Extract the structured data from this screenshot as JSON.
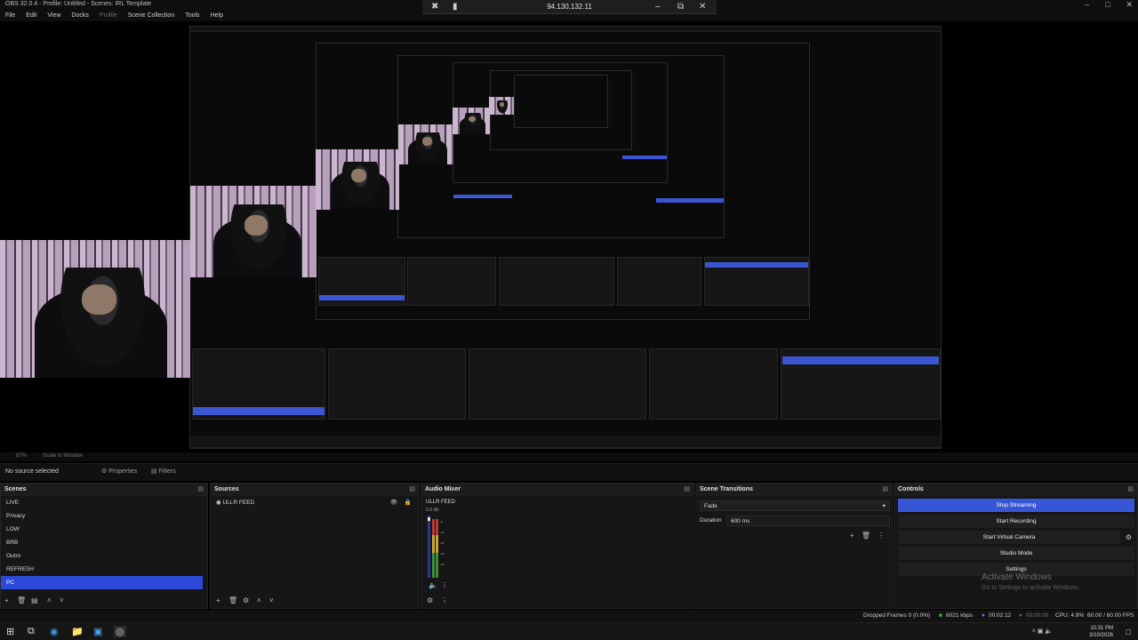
{
  "window": {
    "title": "OBS 32.0.4 - Profile: Untitled - Scenes: IRL Template"
  },
  "menu": [
    "File",
    "Edit",
    "View",
    "Docks",
    "Profile",
    "Scene Collection",
    "Tools",
    "Help"
  ],
  "remote_bar": {
    "ip": "94.130.132.11"
  },
  "preview_strip": {
    "zoom": "87%",
    "scale": "Scale to Window"
  },
  "context_bar": {
    "no_source": "No source selected",
    "properties": "Properties",
    "filters": "Filters"
  },
  "scenes": {
    "title": "Scenes",
    "items": [
      "LIVE",
      "Privacy",
      "LOW",
      "BRB",
      "Outro",
      "REFRESH",
      "PC"
    ],
    "selected": "PC"
  },
  "sources": {
    "title": "Sources",
    "items": [
      "ULLR FEED"
    ]
  },
  "mixer": {
    "title": "Audio Mixer",
    "channel": "ULLR FEED",
    "db": "0.0 dB"
  },
  "transitions": {
    "title": "Scene Transitions",
    "type": "Fade",
    "duration_label": "Duration",
    "duration_value": "600 ms"
  },
  "controls": {
    "title": "Controls",
    "stop_streaming": "Stop Streaming",
    "start_recording": "Start Recording",
    "start_virtual_camera": "Start Virtual Camera",
    "studio_mode": "Studio Mode",
    "settings": "Settings"
  },
  "activate": {
    "line1": "Activate Windows",
    "line2": "Go to Settings to activate Windows."
  },
  "status": {
    "dropped": "Dropped Frames 0 (0.0%)",
    "kbps": "6021 kbps",
    "stream_time": "00:02:12",
    "rec_time": "00:00:00",
    "cpu": "CPU: 4.9%",
    "fps": "60.00 / 60.00 FPS"
  },
  "taskbar": {
    "time": "10:31 PM",
    "date": "3/10/2026"
  },
  "colors": {
    "accent": "#3656d6",
    "selected_scene": "#2b48d8",
    "background": "#161616"
  }
}
